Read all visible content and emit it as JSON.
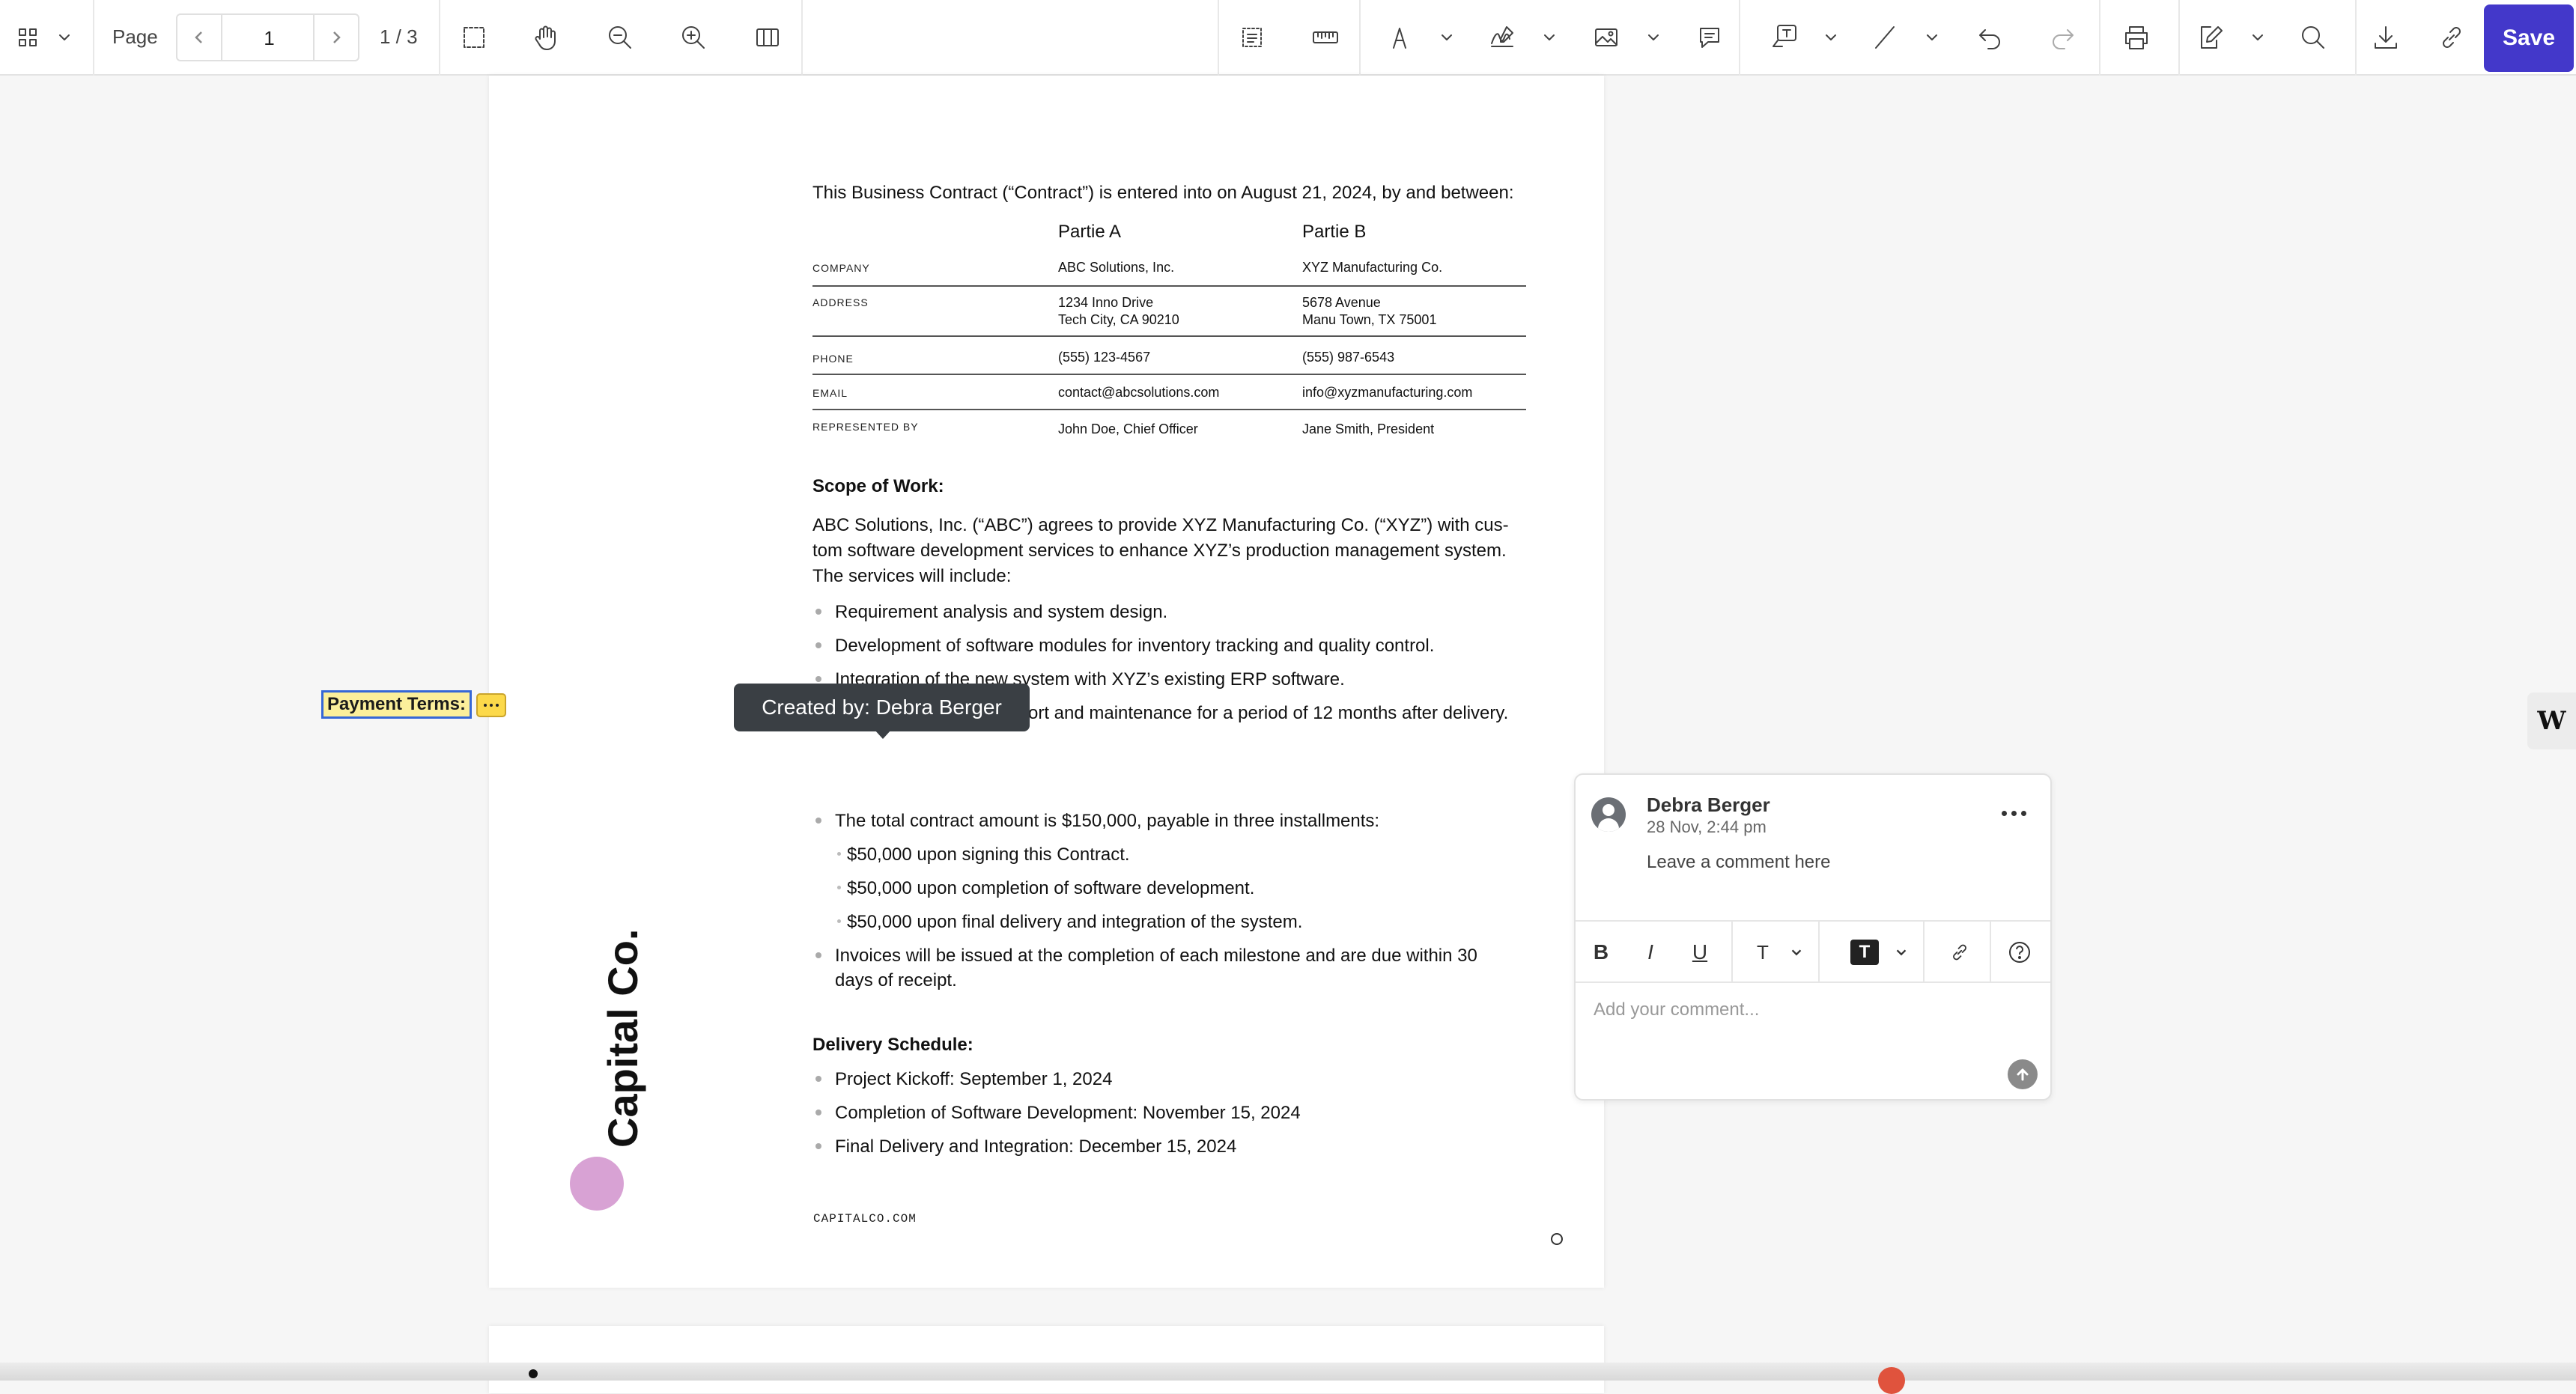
{
  "toolbar": {
    "page_label": "Page",
    "page_value": "1",
    "page_count": "1 / 3",
    "save_label": "Save",
    "accent_color": "#4338ca",
    "icons": [
      "grid-view-icon",
      "marquee-select-icon",
      "hand-pan-icon",
      "zoom-out-icon",
      "zoom-in-icon",
      "two-page-view-icon",
      "form-field-icon",
      "measure-ruler-icon",
      "pen-draw-icon",
      "signature-icon",
      "image-icon",
      "comment-icon",
      "text-callout-icon",
      "line-icon",
      "undo-icon",
      "redo-icon",
      "print-icon",
      "edit-pen-icon",
      "search-icon",
      "download-icon",
      "link-icon"
    ]
  },
  "document": {
    "intro": "This Business Contract (“Contract”) is entered into on August 21, 2024, by and between:",
    "parties": {
      "headers": [
        "Partie A",
        "Partie B"
      ],
      "rows": [
        {
          "label": "COMPANY",
          "a": "ABC Solutions, Inc.",
          "b": "XYZ Manufacturing Co."
        },
        {
          "label": "ADDRESS",
          "a": "1234 Inno Drive",
          "a2": "Tech City, CA 90210",
          "b": "5678 Avenue",
          "b2": "Manu Town, TX 75001"
        },
        {
          "label": "PHONE",
          "a": "(555) 123-4567",
          "b": "(555) 987-6543"
        },
        {
          "label": "EMAIL",
          "a": "contact@abcsolutions.com",
          "b": "info@xyzmanufacturing.com"
        },
        {
          "label": "REPRESENTED BY",
          "a": "John Doe, Chief Officer",
          "b": "Jane Smith, President"
        }
      ]
    },
    "scope": {
      "heading": "Scope of Work:",
      "paragraph": "ABC Solutions, Inc. (“ABC”) agrees to provide XYZ Manufacturing Co. (“XYZ”) with cus-tom software development services to enhance XYZ’s production management system. The services will include:",
      "items": [
        "Requirement analysis and system design.",
        "Development of software modules for inventory tracking and quality control.",
        "Integration of the new system with XYZ’s existing ERP software.",
        "ort and maintenance for a period of 12 months after delivery."
      ]
    },
    "payment": {
      "heading": "Payment Terms:",
      "items": [
        "The total contract amount is $150,000, payable in three installments:",
        "Invoices will be issued at the completion of each milestone and are due within 30",
        "days of receipt."
      ],
      "sub_items": [
        "$50,000 upon signing this Contract.",
        "$50,000 upon completion of software development.",
        "$50,000 upon final delivery and integration of the system."
      ]
    },
    "delivery": {
      "heading": "Delivery Schedule:",
      "items": [
        "Project Kickoff: September 1, 2024",
        "Completion of Software Development: November 15, 2024",
        "Final Delivery and Integration: December 15, 2024"
      ]
    },
    "brand": "Capital Co.",
    "footer": "CAPITALCO.COM"
  },
  "tooltip": "Created by: Debra Berger",
  "comment_panel": {
    "author": "Debra Berger",
    "date": "28 Nov, 2:44 pm",
    "comment": "Leave a comment here",
    "input_placeholder": "Add your comment...",
    "format_buttons": [
      "B",
      "I",
      "U",
      "T",
      "T"
    ]
  },
  "side_widget": "W"
}
